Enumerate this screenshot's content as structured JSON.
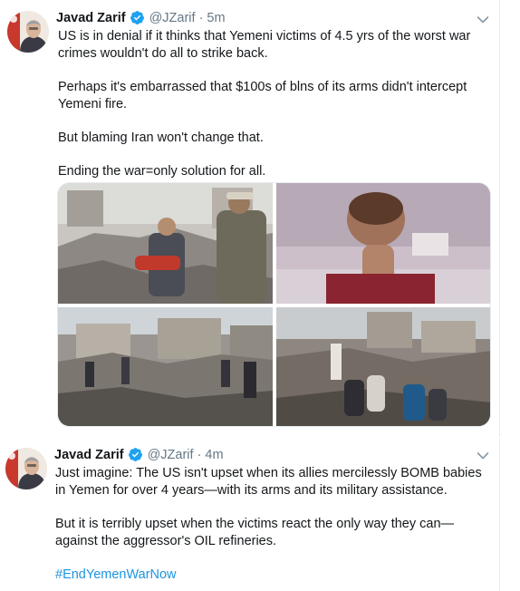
{
  "tweets": [
    {
      "author_name": "Javad Zarif",
      "handle": "@JZarif",
      "separator": "·",
      "time": "5m",
      "paragraphs": [
        "US is in denial if it thinks that Yemeni victims of 4.5 yrs of the worst war crimes wouldn't do all to strike back.",
        "Perhaps it's embarrassed that $100s of blns of its arms didn't intercept Yemeni fire.",
        "But blaming Iran won't change that.",
        "Ending the war=only solution for all."
      ],
      "media_count": 4
    },
    {
      "author_name": "Javad Zarif",
      "handle": "@JZarif",
      "separator": "·",
      "time": "4m",
      "paragraphs": [
        "Just imagine: The US isn't upset when its allies mercilessly BOMB babies in Yemen for over 4 years—with its arms and its military assistance.",
        "But it is terribly upset when the victims react the only way they can—against the aggressor's OIL refineries."
      ],
      "hashtag": "#EndYemenWarNow"
    }
  ],
  "colors": {
    "verified_blue": "#1da1f2",
    "link_blue": "#1b95e0",
    "muted_text": "#657786"
  },
  "icons": [
    "verified-badge-icon",
    "chevron-down-icon"
  ]
}
